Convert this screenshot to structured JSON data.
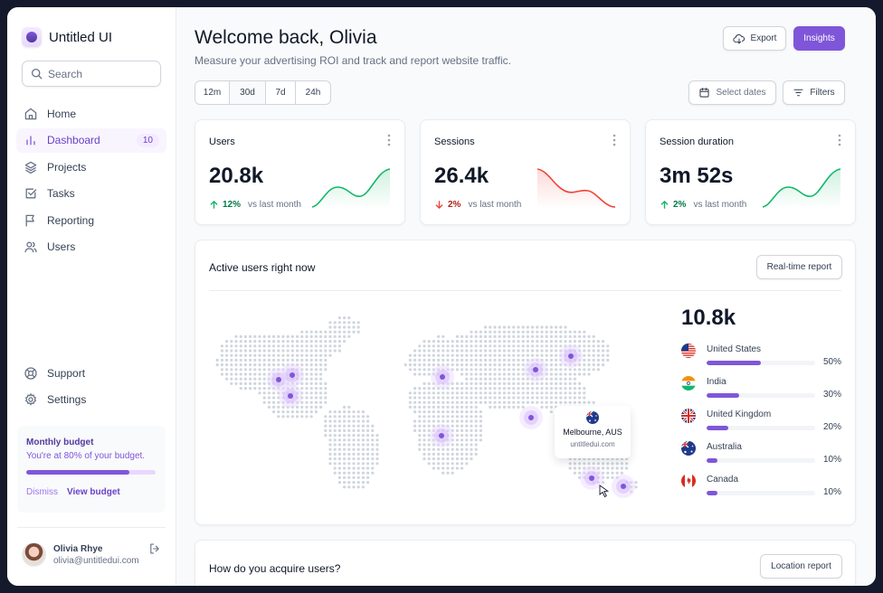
{
  "app": {
    "name": "Untitled UI"
  },
  "search": {
    "placeholder": "Search"
  },
  "nav": {
    "items": [
      {
        "label": "Home",
        "icon": "home-icon"
      },
      {
        "label": "Dashboard",
        "icon": "bar-chart-icon",
        "badge": "10",
        "active": true
      },
      {
        "label": "Projects",
        "icon": "layers-icon"
      },
      {
        "label": "Tasks",
        "icon": "check-square-icon"
      },
      {
        "label": "Reporting",
        "icon": "flag-icon"
      },
      {
        "label": "Users",
        "icon": "users-icon"
      }
    ],
    "bottom": [
      {
        "label": "Support",
        "icon": "life-buoy-icon"
      },
      {
        "label": "Settings",
        "icon": "gear-icon"
      }
    ]
  },
  "budget": {
    "title": "Monthly budget",
    "text": "You're at 80% of your budget.",
    "progress": 0.8,
    "dismiss": "Dismiss",
    "view": "View budget"
  },
  "user": {
    "name": "Olivia Rhye",
    "email": "olivia@untitledui.com"
  },
  "header": {
    "title": "Welcome back, Olivia",
    "subtitle": "Measure your advertising ROI and track and report website traffic.",
    "export": "Export",
    "insights": "Insights"
  },
  "filters": {
    "ranges": [
      "12m",
      "30d",
      "7d",
      "24h"
    ],
    "selected": "30d",
    "select_dates": "Select dates",
    "filters": "Filters"
  },
  "stats": [
    {
      "title": "Users",
      "value": "20.8k",
      "change": "12%",
      "direction": "up",
      "vs": "vs last month",
      "color": "#12b76a"
    },
    {
      "title": "Sessions",
      "value": "26.4k",
      "change": "2%",
      "direction": "down",
      "vs": "vs last month",
      "color": "#f04438"
    },
    {
      "title": "Session duration",
      "value": "3m 52s",
      "change": "2%",
      "direction": "up",
      "vs": "vs last month",
      "color": "#12b76a"
    }
  ],
  "active_users": {
    "title": "Active users right now",
    "button": "Real-time report",
    "total": "10.8k",
    "countries": [
      {
        "name": "United States",
        "pct": "50%",
        "value": 0.5
      },
      {
        "name": "India",
        "pct": "30%",
        "value": 0.3
      },
      {
        "name": "United Kingdom",
        "pct": "20%",
        "value": 0.2
      },
      {
        "name": "Australia",
        "pct": "10%",
        "value": 0.1
      },
      {
        "name": "Canada",
        "pct": "10%",
        "value": 0.1
      }
    ],
    "tooltip": {
      "city": "Melbourne, AUS",
      "url": "untitledui.com"
    }
  },
  "acquire": {
    "title": "How do you acquire users?",
    "button": "Location report"
  },
  "colors": {
    "accent": "#7f56d9",
    "positive": "#12b76a",
    "negative": "#f04438"
  }
}
